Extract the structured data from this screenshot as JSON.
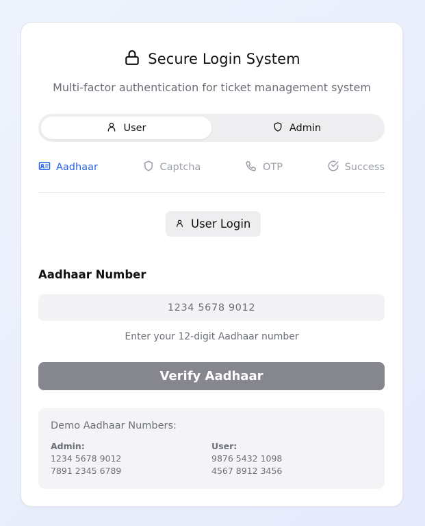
{
  "header": {
    "title": "Secure Login System",
    "subtitle": "Multi-factor authentication for ticket management system"
  },
  "role_tabs": [
    {
      "label": "User",
      "active": true,
      "icon": "user-icon"
    },
    {
      "label": "Admin",
      "active": false,
      "icon": "shield-icon"
    }
  ],
  "steps": [
    {
      "label": "Aadhaar",
      "icon": "id-card-icon",
      "active": true
    },
    {
      "label": "Captcha",
      "icon": "shield-icon",
      "active": false
    },
    {
      "label": "OTP",
      "icon": "phone-icon",
      "active": false
    },
    {
      "label": "Success",
      "icon": "check-circle-icon",
      "active": false
    }
  ],
  "mode_badge": "User Login",
  "form": {
    "label": "Aadhaar Number",
    "placeholder": "1234 5678 9012",
    "value": "",
    "hint": "Enter your 12-digit Aadhaar number",
    "submit_label": "Verify Aadhaar"
  },
  "demo": {
    "title": "Demo Aadhaar Numbers:",
    "admin": {
      "heading": "Admin:",
      "numbers": [
        "1234 5678 9012",
        "7891 2345 6789"
      ]
    },
    "user": {
      "heading": "User:",
      "numbers": [
        "9876 5432 1098",
        "4567 8912 3456"
      ]
    }
  },
  "colors": {
    "accent": "#2563eb",
    "inactive": "#9a9ea6",
    "button": "#85868e"
  }
}
